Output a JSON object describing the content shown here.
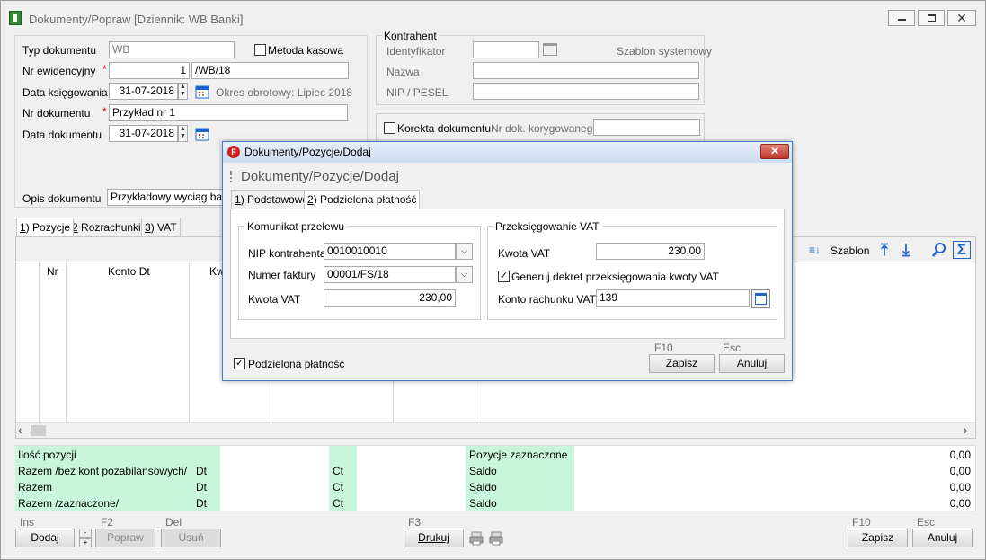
{
  "window": {
    "title": "Dokumenty/Popraw [Dziennik: WB  Banki]"
  },
  "form": {
    "typ_label": "Typ dokumentu",
    "typ_value": "WB",
    "metoda_kasowa_label": "Metoda kasowa",
    "nr_ewid_label": "Nr ewidencyjny",
    "nr_ewid_num": "1",
    "nr_ewid_suffix": "/WB/18",
    "data_ksieg_label": "Data księgowania",
    "data_ksieg_value": "31-07-2018",
    "okres_text": "Okres obrotowy: Lipiec 2018",
    "nr_dok_label": "Nr dokumentu",
    "nr_dok_value": "Przykład nr 1",
    "data_dok_label": "Data dokumentu",
    "data_dok_value": "31-07-2018",
    "opis_label": "Opis dokumentu",
    "opis_value": "Przykładowy wyciąg bank",
    "required_mark": "*"
  },
  "kontrahent": {
    "group_label": "Kontrahent",
    "identyfikator_label": "Identyfikator",
    "szablon_label": "Szablon systemowy",
    "nazwa_label": "Nazwa",
    "nip_label": "NIP / PESEL",
    "korekta_label": "Korekta dokumentu",
    "nr_kor_label": "Nr dok. korygowanego"
  },
  "tabs": {
    "items": [
      {
        "key": "1",
        "label": ") Pozycje"
      },
      {
        "key": "2",
        "label": " Rozrachunki"
      },
      {
        "key": "3",
        "label": ") VAT"
      }
    ]
  },
  "grid": {
    "col_nr": "Nr",
    "col_konto_dt": "Konto Dt",
    "col_kw": "Kw",
    "szablon_label": "Szablon"
  },
  "summary": {
    "rows": [
      {
        "label": "Ilość pozycji",
        "dt": "",
        "ct": "",
        "right_label": "Pozycje zaznaczone",
        "value": "0,00"
      },
      {
        "label": "Razem /bez kont pozabilansowych/",
        "dt": "Dt",
        "ct": "Ct",
        "right_label": "Saldo",
        "value": "0,00"
      },
      {
        "label": "Razem",
        "dt": "Dt",
        "ct": "Ct",
        "right_label": "Saldo",
        "value": "0,00"
      },
      {
        "label": "Razem /zaznaczone/",
        "dt": "Dt",
        "ct": "Ct",
        "right_label": "Saldo",
        "value": "0,00"
      }
    ]
  },
  "bottom_bar": {
    "ins_key": "Ins",
    "dodaj_label": "Dodaj",
    "f2_key": "F2",
    "popraw_label": "Popraw",
    "del_key": "Del",
    "usun_label": "Usuń",
    "f3_key": "F3",
    "drukuj_label": "Drukuj",
    "f10_key": "F10",
    "zapisz_label": "Zapisz",
    "esc_key": "Esc",
    "anuluj_label": "Anuluj"
  },
  "dialog": {
    "title": "Dokumenty/Pozycje/Dodaj",
    "header": "Dokumenty/Pozycje/Dodaj",
    "tab1_key": "1",
    "tab1_label": ") Podstawowe",
    "tab2_key": "2",
    "tab2_label": ") Podzielona płatność",
    "komunikat_group": "Komunikat przelewu",
    "nip_label": "NIP kontrahenta",
    "nip_value": "0010010010",
    "numer_label": "Numer faktury",
    "numer_value": "00001/FS/18",
    "kwota_vat_label": "Kwota VAT",
    "kwota_vat_value": "230,00",
    "przeks_group": "Przeksięgowanie VAT",
    "przeks_kwota_label": "Kwota VAT",
    "przeks_kwota_value": "230,00",
    "generuj_label": "Generuj dekret przeksięgowania kwoty VAT",
    "konto_label": "Konto rachunku VAT",
    "konto_value": "139",
    "podzielona_label": "Podzielona płatność",
    "f10_key": "F10",
    "zapisz_label": "Zapisz",
    "esc_key": "Esc",
    "anuluj_label": "Anuluj"
  },
  "colors": {
    "accent_blue": "#1e64c8",
    "summary_green": "#c8f5dc",
    "dialog_close_red": "#c0392b"
  }
}
